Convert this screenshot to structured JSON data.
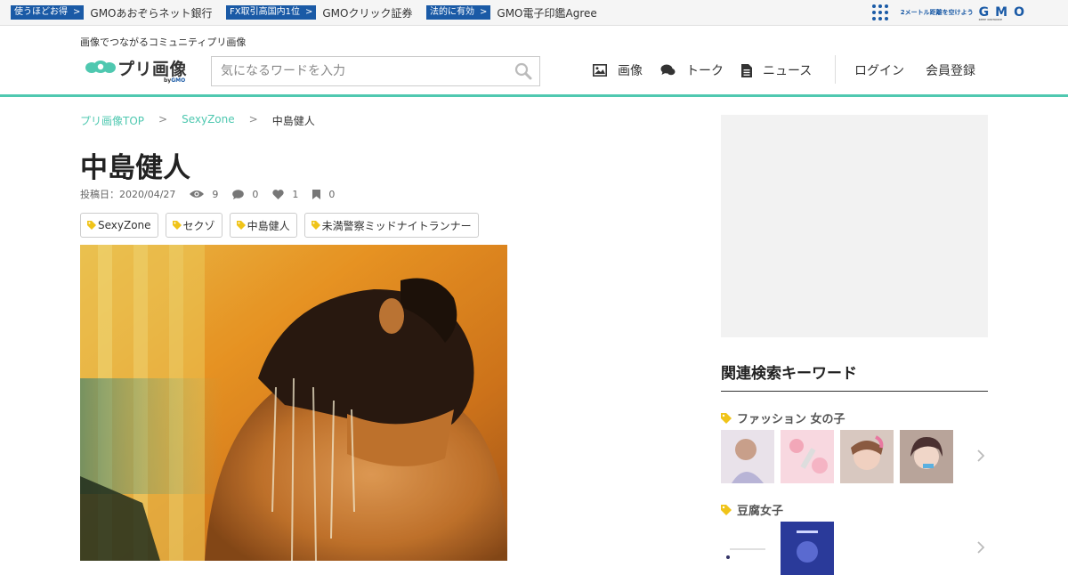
{
  "gmo_bar": {
    "items": [
      {
        "badge": "使うほどお得",
        "link": "GMOあおぞらネット銀行"
      },
      {
        "badge": "FX取引高国内1位",
        "link": "GMOクリック証券"
      },
      {
        "badge": "法的に有効",
        "link": "GMO電子印鑑Agree"
      }
    ],
    "arrow": ">",
    "distance_text": "2メートル距離を空けよう",
    "logo_text": "GMO",
    "logo_sub": "KEEP DISTANCE"
  },
  "header": {
    "tagline": "画像でつながるコミュニティプリ画像",
    "logo_text": "プリ画像",
    "logo_by": "by",
    "logo_by_brand": "GMO",
    "search_placeholder": "気になるワードを入力",
    "nav": [
      {
        "label": "画像",
        "icon": "image-icon"
      },
      {
        "label": "トーク",
        "icon": "chat-icon"
      },
      {
        "label": "ニュース",
        "icon": "document-icon"
      }
    ],
    "login": "ログイン",
    "register": "会員登録"
  },
  "breadcrumb": {
    "items": [
      "プリ画像TOP",
      "SexyZone"
    ],
    "separator": ">",
    "current": "中島健人"
  },
  "post": {
    "title": "中島健人",
    "date_label": "投稿日：2020/04/27",
    "views": "9",
    "comments": "0",
    "likes": "1",
    "bookmarks": "0",
    "tags": [
      "SexyZone",
      "セクゾ",
      "中島健人",
      "未満警察ミッドナイトランナー"
    ]
  },
  "sidebar": {
    "related_title": "関連検索キーワード",
    "keywords": [
      {
        "label": "ファッション 女の子"
      },
      {
        "label": "豆腐女子"
      }
    ]
  },
  "colors": {
    "accent": "#4fc8b0",
    "gmo_blue": "#1a5aa6",
    "tag_icon": "#f0c419"
  }
}
